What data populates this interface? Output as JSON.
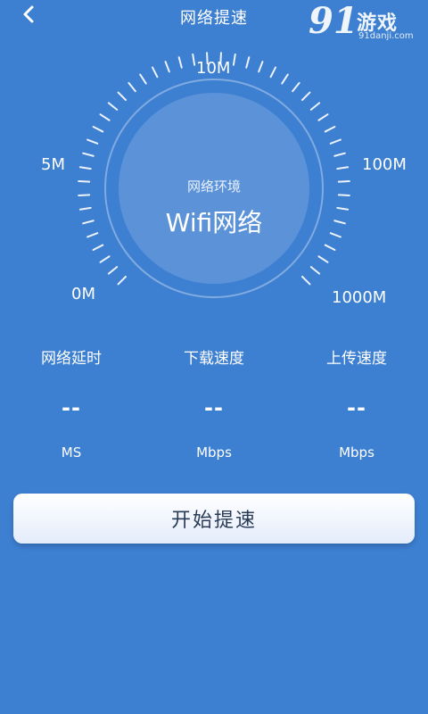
{
  "header": {
    "title": "网络提速",
    "back_icon": "chevron-left-icon"
  },
  "watermark": {
    "brand_number": "91",
    "brand_text": "游戏",
    "domain": "91danji.com"
  },
  "gauge": {
    "labels": {
      "l0": "0M",
      "l5": "5M",
      "l10": "10M",
      "l100": "100M",
      "l1000": "1000M"
    },
    "env_label": "网络环境",
    "env_value": "Wifi网络"
  },
  "stats": {
    "latency": {
      "title": "网络延时",
      "value": "--",
      "unit": "MS"
    },
    "download": {
      "title": "下载速度",
      "value": "--",
      "unit": "Mbps"
    },
    "upload": {
      "title": "上传速度",
      "value": "--",
      "unit": "Mbps"
    }
  },
  "start_button": {
    "label": "开始提速"
  },
  "colors": {
    "background": "#3d7fd1",
    "button_text": "#2a3b57"
  }
}
